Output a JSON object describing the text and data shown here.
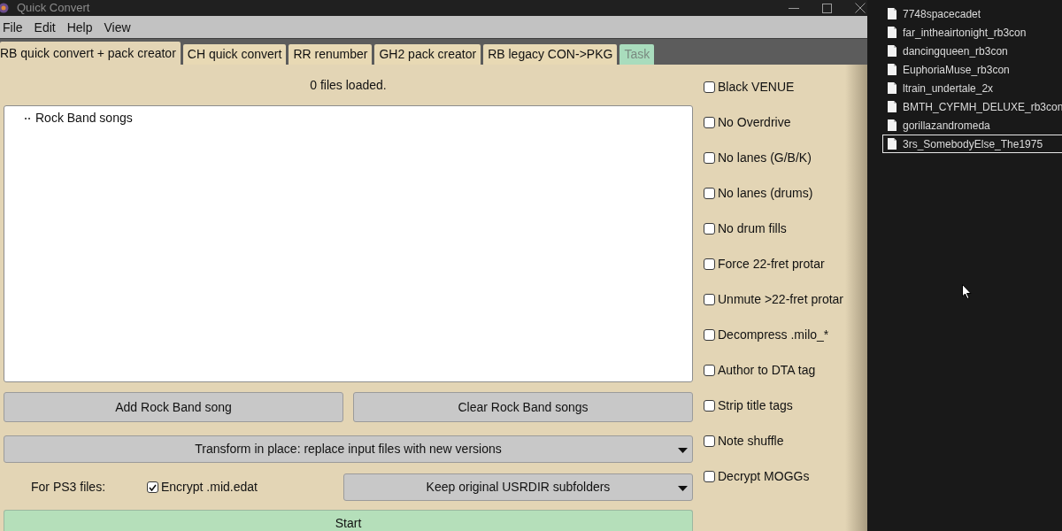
{
  "window": {
    "title": "Quick Convert"
  },
  "menu": [
    "File",
    "Edit",
    "Help",
    "View"
  ],
  "tabs": [
    {
      "label": "RB quick convert + pack creator",
      "selected": true,
      "disabled": false
    },
    {
      "label": "CH quick convert",
      "selected": false,
      "disabled": false
    },
    {
      "label": "RR renumber",
      "selected": false,
      "disabled": false
    },
    {
      "label": "GH2 pack creator",
      "selected": false,
      "disabled": false
    },
    {
      "label": "RB legacy CON->PKG",
      "selected": false,
      "disabled": false
    },
    {
      "label": "Task",
      "selected": false,
      "disabled": true
    }
  ],
  "status": "0 files loaded.",
  "song_tree": {
    "root": "Rock Band songs"
  },
  "song_buttons": [
    "Add Rock Band song",
    "Clear Rock Band songs"
  ],
  "output_mode": {
    "value": "Transform in place: replace input files with new versions"
  },
  "ps3": {
    "label": "For PS3 files:",
    "encrypt": {
      "label": "Encrypt .mid.edat",
      "checked": true
    },
    "folder_mode": {
      "value": "Keep original USRDIR subfolders"
    }
  },
  "start_button": "Start",
  "options": [
    {
      "label": "Black VENUE",
      "checked": false
    },
    {
      "label": "No Overdrive",
      "checked": false
    },
    {
      "label": "No lanes (G/B/K)",
      "checked": false
    },
    {
      "label": "No lanes (drums)",
      "checked": false
    },
    {
      "label": "No drum fills",
      "checked": false
    },
    {
      "label": "Force 22-fret protar",
      "checked": false
    },
    {
      "label": "Unmute >22-fret protar",
      "checked": false
    },
    {
      "label": "Decompress .milo_*",
      "checked": false
    },
    {
      "label": "Author to DTA tag",
      "checked": false
    },
    {
      "label": "Strip title tags",
      "checked": false
    },
    {
      "label": "Note shuffle",
      "checked": false
    },
    {
      "label": "Decrypt MOGGs",
      "checked": false
    }
  ],
  "file_explorer": {
    "files": [
      {
        "name": "7748spacecadet",
        "selected": false
      },
      {
        "name": "far_intheairtonight_rb3con",
        "selected": false
      },
      {
        "name": "dancingqueen_rb3con",
        "selected": false
      },
      {
        "name": "EuphoriaMuse_rb3con",
        "selected": false
      },
      {
        "name": "ltrain_undertale_2x",
        "selected": false
      },
      {
        "name": "BMTH_CYFMH_DELUXE_rb3con",
        "selected": false
      },
      {
        "name": "gorillazandromeda",
        "selected": false
      },
      {
        "name": "3rs_SomebodyElse_The1975",
        "selected": true
      }
    ]
  }
}
